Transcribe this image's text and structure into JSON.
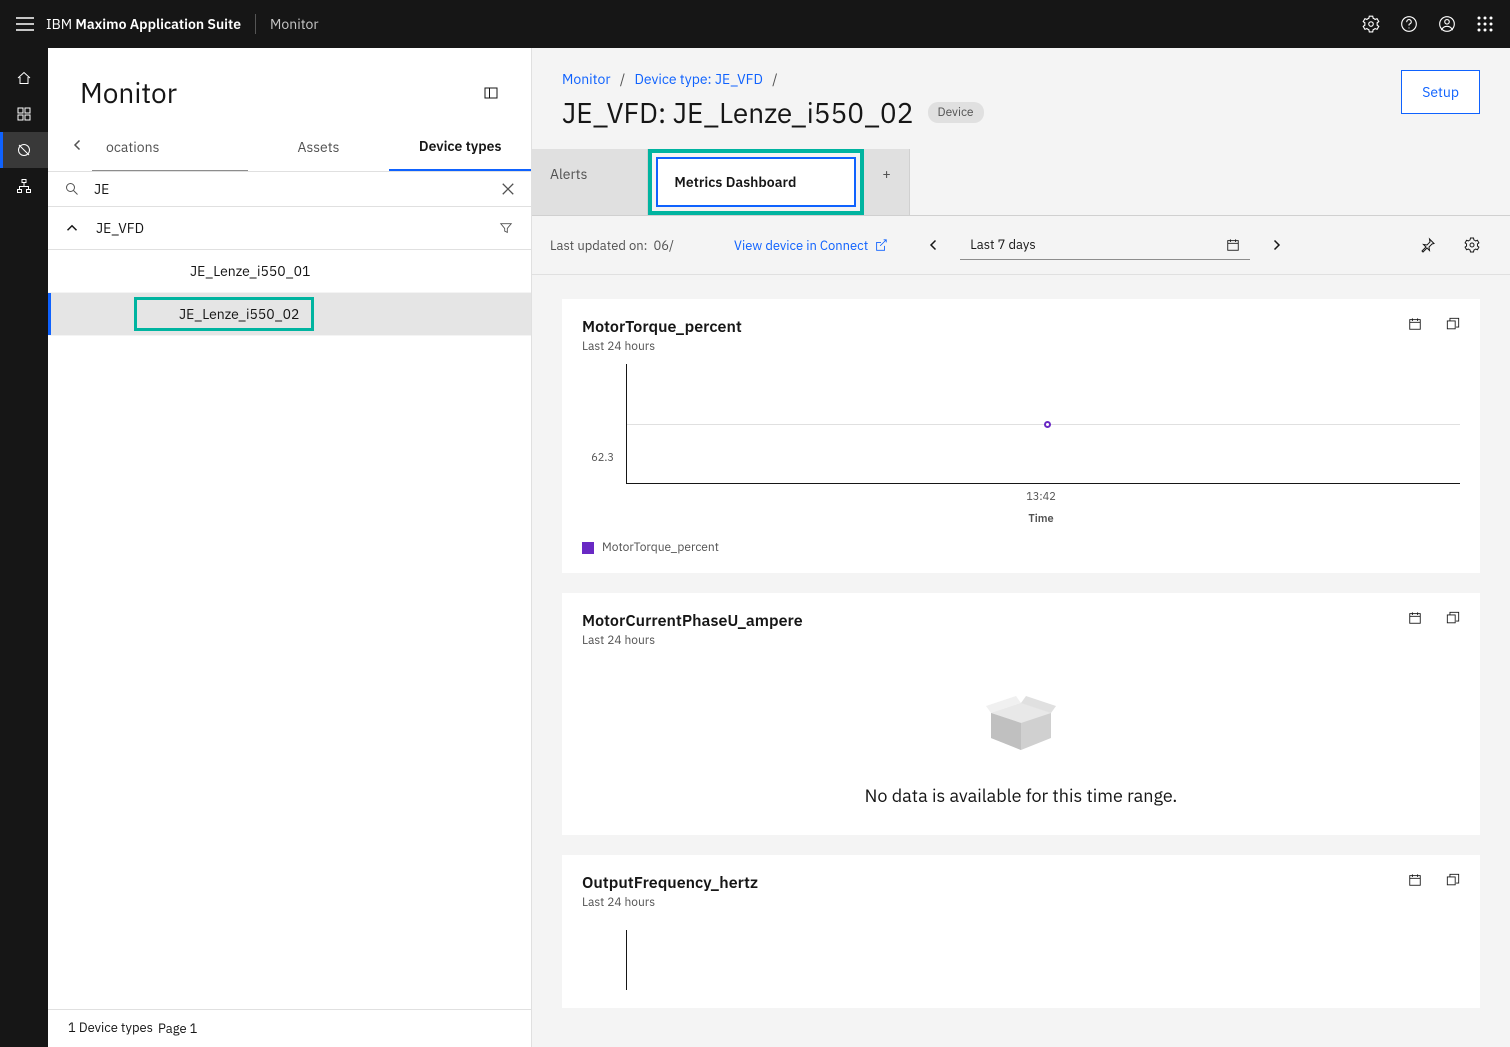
{
  "header": {
    "brand_prefix": "IBM ",
    "brand_bold": "Maximo Application Suite",
    "app_name": "Monitor"
  },
  "sidebar": {
    "title": "Monitor",
    "tabs": {
      "locations": "ocations",
      "assets": "Assets",
      "device_types": "Device types"
    },
    "search_value": "JE",
    "group_label": "JE_VFD",
    "items": [
      {
        "label": "JE_Lenze_i550_01"
      },
      {
        "label": "JE_Lenze_i550_02"
      }
    ],
    "footer_count": "1 Device types",
    "footer_page": "Page 1"
  },
  "content": {
    "breadcrumbs": {
      "root": "Monitor",
      "mid": "Device type: JE_VFD"
    },
    "title": "JE_VFD: JE_Lenze_i550_02",
    "badge": "Device",
    "setup": "Setup",
    "tabs": {
      "alerts": "Alerts",
      "metrics": "Metrics Dashboard",
      "add": "+"
    },
    "toolbar": {
      "updated_label": "Last updated on:",
      "updated_value": "06/",
      "view_link": "View device in Connect",
      "range": "Last 7 days"
    },
    "cards": [
      {
        "title": "MotorTorque_percent",
        "subtitle": "Last 24 hours",
        "type": "chart",
        "y_value": "62.3",
        "x_tick": "13:42",
        "x_label": "Time",
        "legend": "MotorTorque_percent"
      },
      {
        "title": "MotorCurrentPhaseU_ampere",
        "subtitle": "Last 24 hours",
        "type": "empty",
        "empty_text": "No data is available for this time range."
      },
      {
        "title": "OutputFrequency_hertz",
        "subtitle": "Last 24 hours",
        "type": "chart_partial"
      }
    ]
  },
  "chart_data": [
    {
      "type": "scatter",
      "title": "MotorTorque_percent",
      "xlabel": "Time",
      "ylabel": "",
      "series": [
        {
          "name": "MotorTorque_percent",
          "x": [
            "13:42"
          ],
          "y": [
            62.3
          ]
        }
      ]
    }
  ]
}
